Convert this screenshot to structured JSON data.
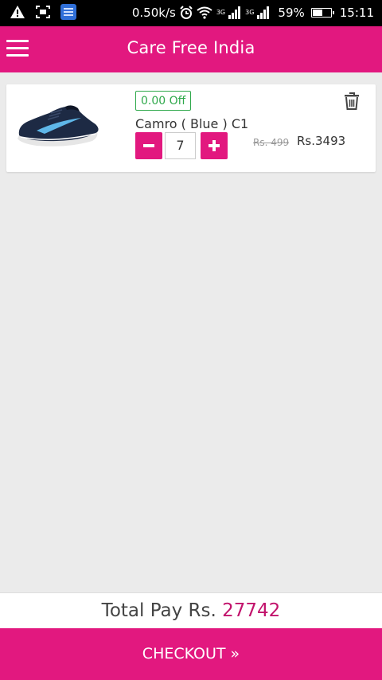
{
  "status_bar": {
    "speed": "0.50k/s",
    "network_1": "3G",
    "network_2": "3G",
    "battery": "59%",
    "battery_level": 0.59,
    "time": "15:11",
    "icons": [
      "warning-icon",
      "screenshot-icon",
      "app-notification-icon",
      "alarm-icon",
      "wifi-icon",
      "signal-icon",
      "signal-icon",
      "battery-icon"
    ]
  },
  "app_bar": {
    "title": "Care Free India",
    "menu_icon": "hamburger-menu-icon"
  },
  "cart": {
    "items": [
      {
        "discount": "0.00 Off",
        "name": "Camro ( Blue ) C1",
        "quantity": "7",
        "original_price": "Rs. 499",
        "price": "Rs.3493",
        "delete_icon": "trash-icon",
        "image": "shoe-image"
      }
    ]
  },
  "footer": {
    "total_label": "Total Pay Rs.",
    "total_amount": "27742",
    "checkout_label": "CHECKOUT »"
  },
  "colors": {
    "brand": "#e2187f",
    "total_amount": "#c2136c",
    "discount_green": "#2ea84a",
    "background": "#ebebeb"
  }
}
